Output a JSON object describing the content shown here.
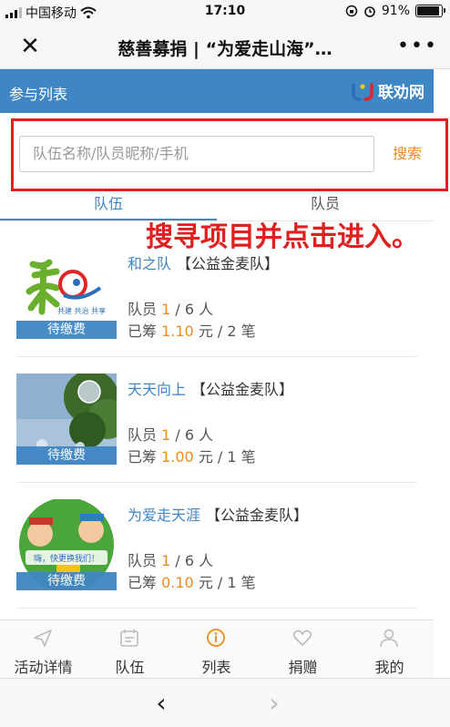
{
  "status_bar": {
    "carrier": "中国移动",
    "time": "17:10",
    "battery": "91%",
    "battery_level": 0.91
  },
  "nav": {
    "title": "慈善募捐 | “为爱走山海”…"
  },
  "header": {
    "title": "参与列表",
    "brand": "联劝网"
  },
  "search": {
    "placeholder": "队伍名称/队员昵称/手机",
    "button": "搜索"
  },
  "tabs": [
    {
      "label": "队伍",
      "active": true
    },
    {
      "label": "队员",
      "active": false
    }
  ],
  "annotation": "搜寻项目并点击进入。",
  "teams": [
    {
      "name": "和之队",
      "group": "【公益金麦队】",
      "status": "待缴费",
      "members_label": "队员",
      "members": "1",
      "members_total": "/ 6 人",
      "raised_label": "已筹",
      "raised": "1.10",
      "raised_suffix": "元 / 2 笔",
      "thumb_text": "共建 共治 共享"
    },
    {
      "name": "天天向上",
      "group": "【公益金麦队】",
      "status": "待缴费",
      "members_label": "队员",
      "members": "1",
      "members_total": "/ 6 人",
      "raised_label": "已筹",
      "raised": "1.00",
      "raised_suffix": "元 / 1 笔"
    },
    {
      "name": "为爱走天涯",
      "group": "【公益金麦队】",
      "status": "待缴费",
      "members_label": "队员",
      "members": "1",
      "members_total": "/ 6 人",
      "raised_label": "已筹",
      "raised": "0.10",
      "raised_suffix": "元 / 1 笔",
      "thumb_text": "嗨，快更换我们！"
    }
  ],
  "bottom_tabs": [
    {
      "label": "活动详情",
      "icon": "send-icon"
    },
    {
      "label": "队伍",
      "icon": "team-icon"
    },
    {
      "label": "列表",
      "icon": "info-icon",
      "active": true
    },
    {
      "label": "捐赠",
      "icon": "heart-icon"
    },
    {
      "label": "我的",
      "icon": "user-icon"
    }
  ],
  "browser": {
    "back": "‹",
    "forward": "›"
  },
  "colors": {
    "accent_blue": "#3f86c4",
    "highlight_orange": "#f08a1c",
    "annotation_red": "#e01f1f"
  }
}
